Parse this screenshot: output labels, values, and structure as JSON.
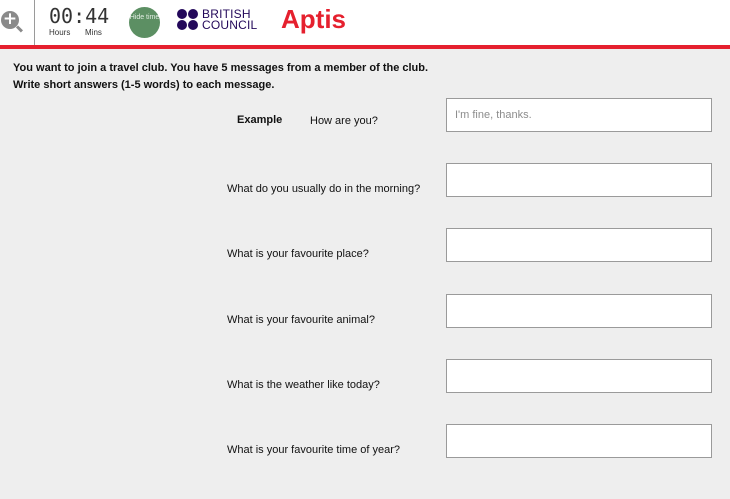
{
  "header": {
    "timer": {
      "value": "00:44",
      "hours_label": "Hours",
      "mins_label": "Mins"
    },
    "hide_time_label": "Hide time",
    "brand": {
      "line1": "BRITISH",
      "line2": "COUNCIL",
      "color": "#23085a"
    },
    "product": {
      "name": "Aptis",
      "color": "#e5202e"
    },
    "icons": {
      "zoom": "zoom-in-icon"
    }
  },
  "task": {
    "instruction_line1": "You want to join a travel club. You have 5 messages from a member of the club.",
    "instruction_line2": "Write short answers (1-5 words) to each message.",
    "example": {
      "label": "Example",
      "question": "How are you?",
      "placeholder": "I'm fine, thanks."
    },
    "questions": [
      {
        "text": "What do you usually do in the morning?",
        "value": ""
      },
      {
        "text": "What is your favourite place?",
        "value": ""
      },
      {
        "text": "What is your favourite animal?",
        "value": ""
      },
      {
        "text": "What is the weather like today?",
        "value": ""
      },
      {
        "text": "What is your favourite time of year?",
        "value": ""
      }
    ]
  },
  "colors": {
    "accent": "#e5202e",
    "background": "#eeeeee"
  }
}
